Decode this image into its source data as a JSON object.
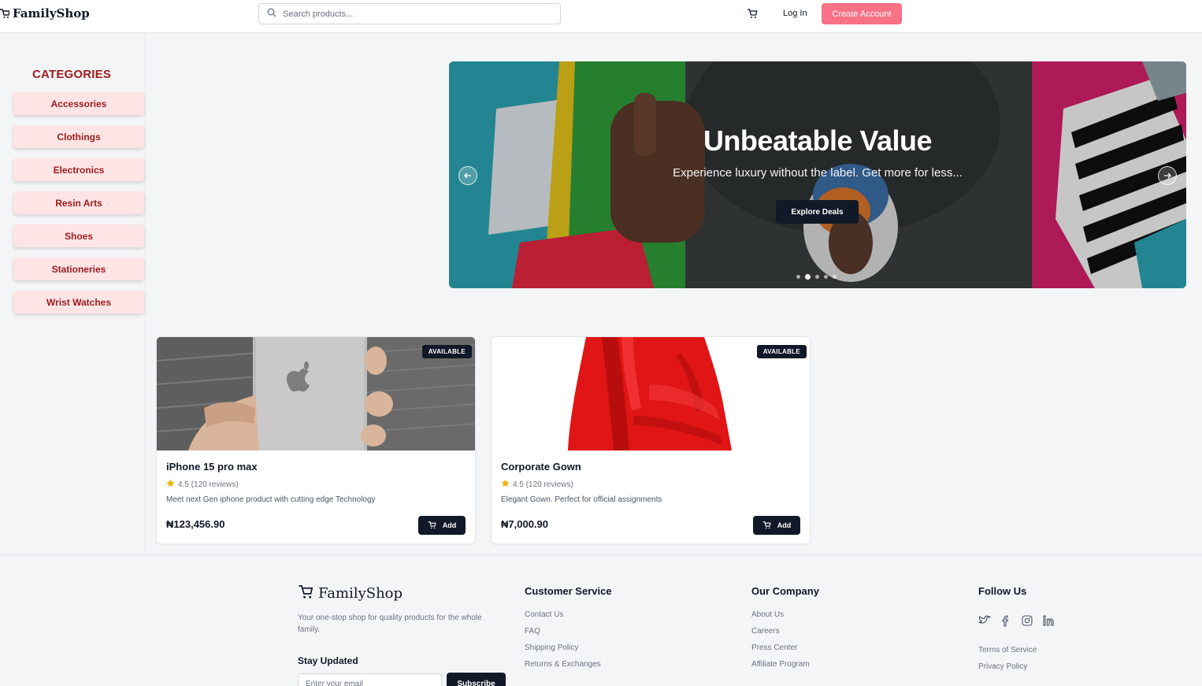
{
  "header": {
    "logo_text": "FamilyShop",
    "search_placeholder": "Search products...",
    "login_label": "Log In",
    "create_account_label": "Create Account"
  },
  "sidebar": {
    "title": "CATEGORIES",
    "items": [
      "Accessories",
      "Clothings",
      "Electronics",
      "Resin Arts",
      "Shoes",
      "Stationeries",
      "Wrist Watches"
    ]
  },
  "hero": {
    "title": "Unbeatable Value",
    "subtitle": "Experience luxury without the label. Get more for less...",
    "button_label": "Explore Deals",
    "slide_count": 5,
    "active_slide": 2
  },
  "products": [
    {
      "name": "iPhone 15 pro max",
      "badge": "AVAILABLE",
      "rating": "4.5 (120 reviews)",
      "description": "Meet next Gen iphone product with cutting edge Technology",
      "price": "₦123,456.90",
      "add_label": "Add"
    },
    {
      "name": "Corporate Gown",
      "badge": "AVAILABLE",
      "rating": "4.5 (120 reviews)",
      "description": "Elegant Gown. Perfect for official assignments",
      "price": "₦7,000.90",
      "add_label": "Add"
    }
  ],
  "footer": {
    "logo_text": "FamilyShop",
    "description": "Your one-stop shop for quality products for the whole family.",
    "stay_updated": "Stay Updated",
    "email_placeholder": "Enter your email",
    "subscribe_label": "Subscribe",
    "customer_service": {
      "title": "Customer Service",
      "links": [
        "Contact Us",
        "FAQ",
        "Shipping Policy",
        "Returns & Exchanges"
      ]
    },
    "company": {
      "title": "Our Company",
      "links": [
        "About Us",
        "Careers",
        "Press Center",
        "Affiliate Program"
      ]
    },
    "follow": {
      "title": "Follow Us",
      "icons": [
        "twitter-icon",
        "facebook-icon",
        "instagram-icon",
        "linkedin-icon"
      ],
      "links": [
        "Terms of Service",
        "Privacy Policy"
      ]
    }
  },
  "colors": {
    "accent": "#f87185",
    "category_text": "#9b1c1c",
    "category_bg": "#ffe4e6",
    "dark": "#111827",
    "star": "#f5b301"
  }
}
